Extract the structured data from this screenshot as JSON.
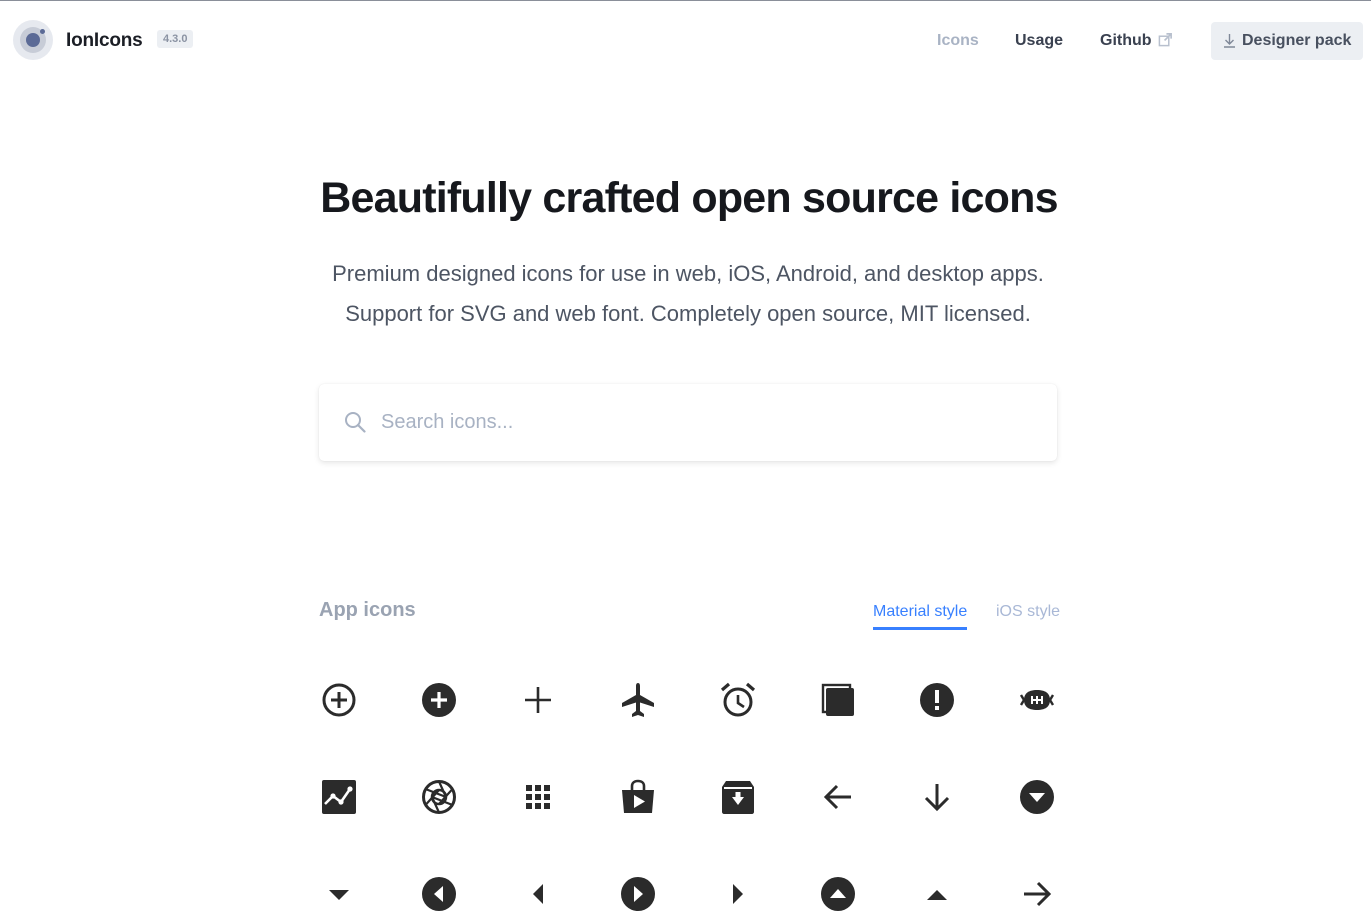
{
  "header": {
    "brand": "IonIcons",
    "version": "4.3.0",
    "nav": {
      "icons": "Icons",
      "usage": "Usage",
      "github": "Github"
    },
    "designer_pack": "Designer pack"
  },
  "hero": {
    "title": "Beautifully crafted open source icons",
    "subtitle_line1": "Premium designed icons for use in web, iOS, Android, and desktop apps.",
    "subtitle_line2": "Support for SVG and web font. Completely open source, MIT licensed."
  },
  "search": {
    "placeholder": "Search icons...",
    "value": ""
  },
  "section": {
    "title": "App icons",
    "tabs": {
      "material": "Material style",
      "ios": "iOS style"
    },
    "active_tab": "material"
  },
  "icons": [
    [
      "add-circle-outline-icon",
      "add-circle-icon",
      "add-icon",
      "airplane-icon",
      "alarm-icon",
      "albums-icon",
      "alert-icon",
      "american-football-icon"
    ],
    [
      "analytics-icon",
      "aperture-icon",
      "apps-icon",
      "appstore-icon",
      "archive-icon",
      "arrow-back-icon",
      "arrow-down-icon",
      "arrow-dropdown-circle-icon"
    ],
    [
      "arrow-dropdown-icon",
      "arrow-dropleft-circle-icon",
      "arrow-dropleft-icon",
      "arrow-dropright-circle-icon",
      "arrow-dropright-icon",
      "arrow-dropup-circle-icon",
      "arrow-dropup-icon",
      "arrow-forward-icon"
    ]
  ],
  "colors": {
    "accent": "#3880ff",
    "icon": "#2b2b2b",
    "muted": "#9aa3b2"
  }
}
